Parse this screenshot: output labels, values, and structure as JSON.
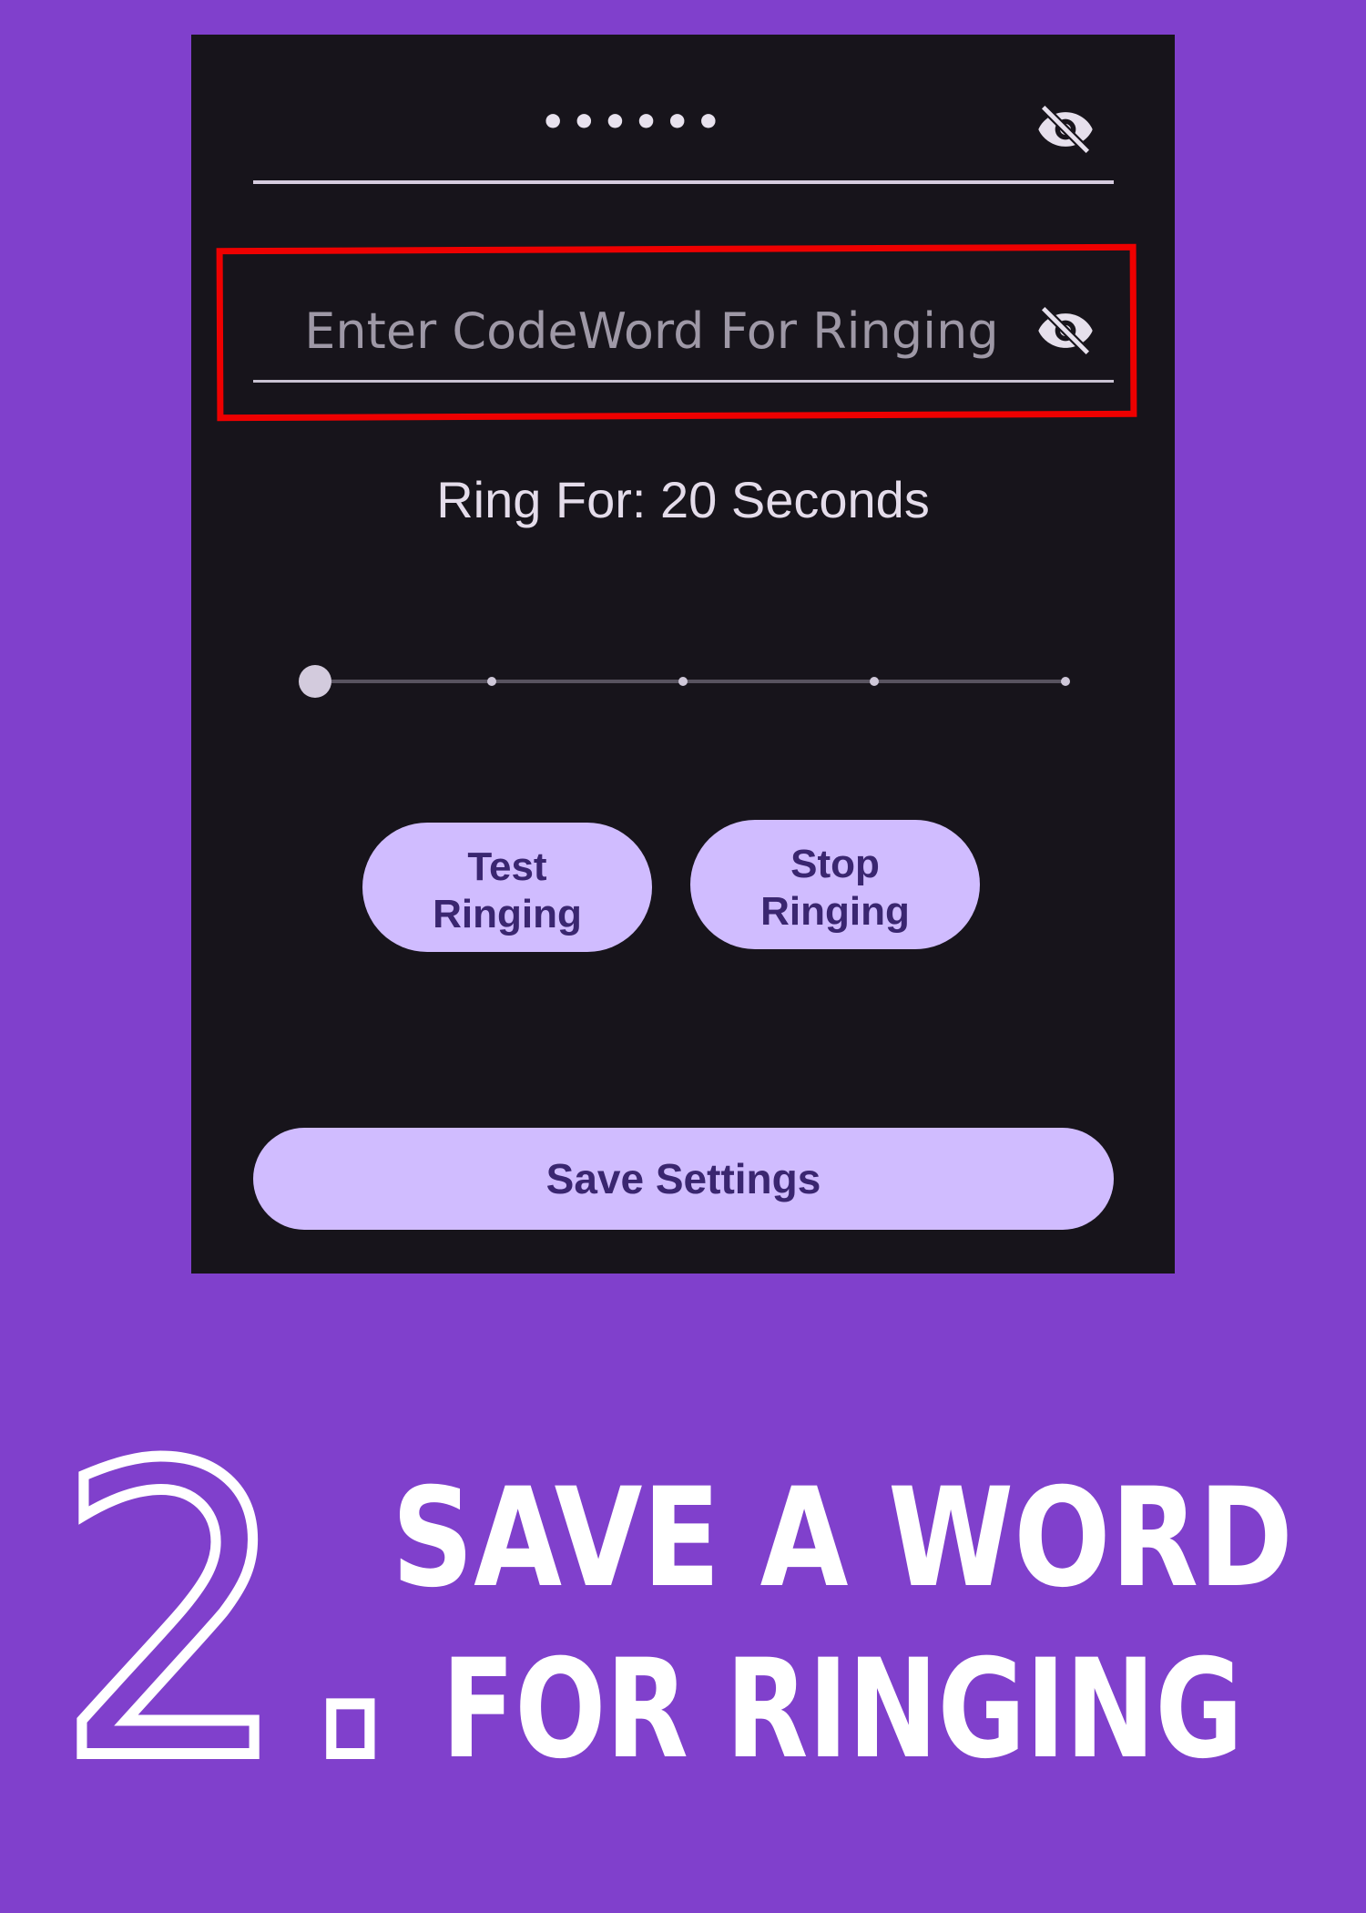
{
  "settings": {
    "password_field": {
      "masked_value": "••••••",
      "icon": "visibility-off-icon"
    },
    "codeword_field": {
      "placeholder": "Enter CodeWord For Ringing",
      "icon": "visibility-off-icon"
    },
    "ring_label": "Ring For: 20 Seconds",
    "ring_slider": {
      "value_index": 0,
      "steps": 5
    },
    "test_button": "Test\nRinging",
    "stop_button": "Stop\nRinging",
    "save_button": "Save Settings"
  },
  "caption": {
    "step_number": "2.",
    "line1": "SAVE A WORD",
    "line2": "FOR RINGING"
  },
  "colors": {
    "background": "#8040cc",
    "panel": "#17141b",
    "button": "#d0bcff",
    "button_text": "#3a2670",
    "highlight": "#ee0000"
  }
}
